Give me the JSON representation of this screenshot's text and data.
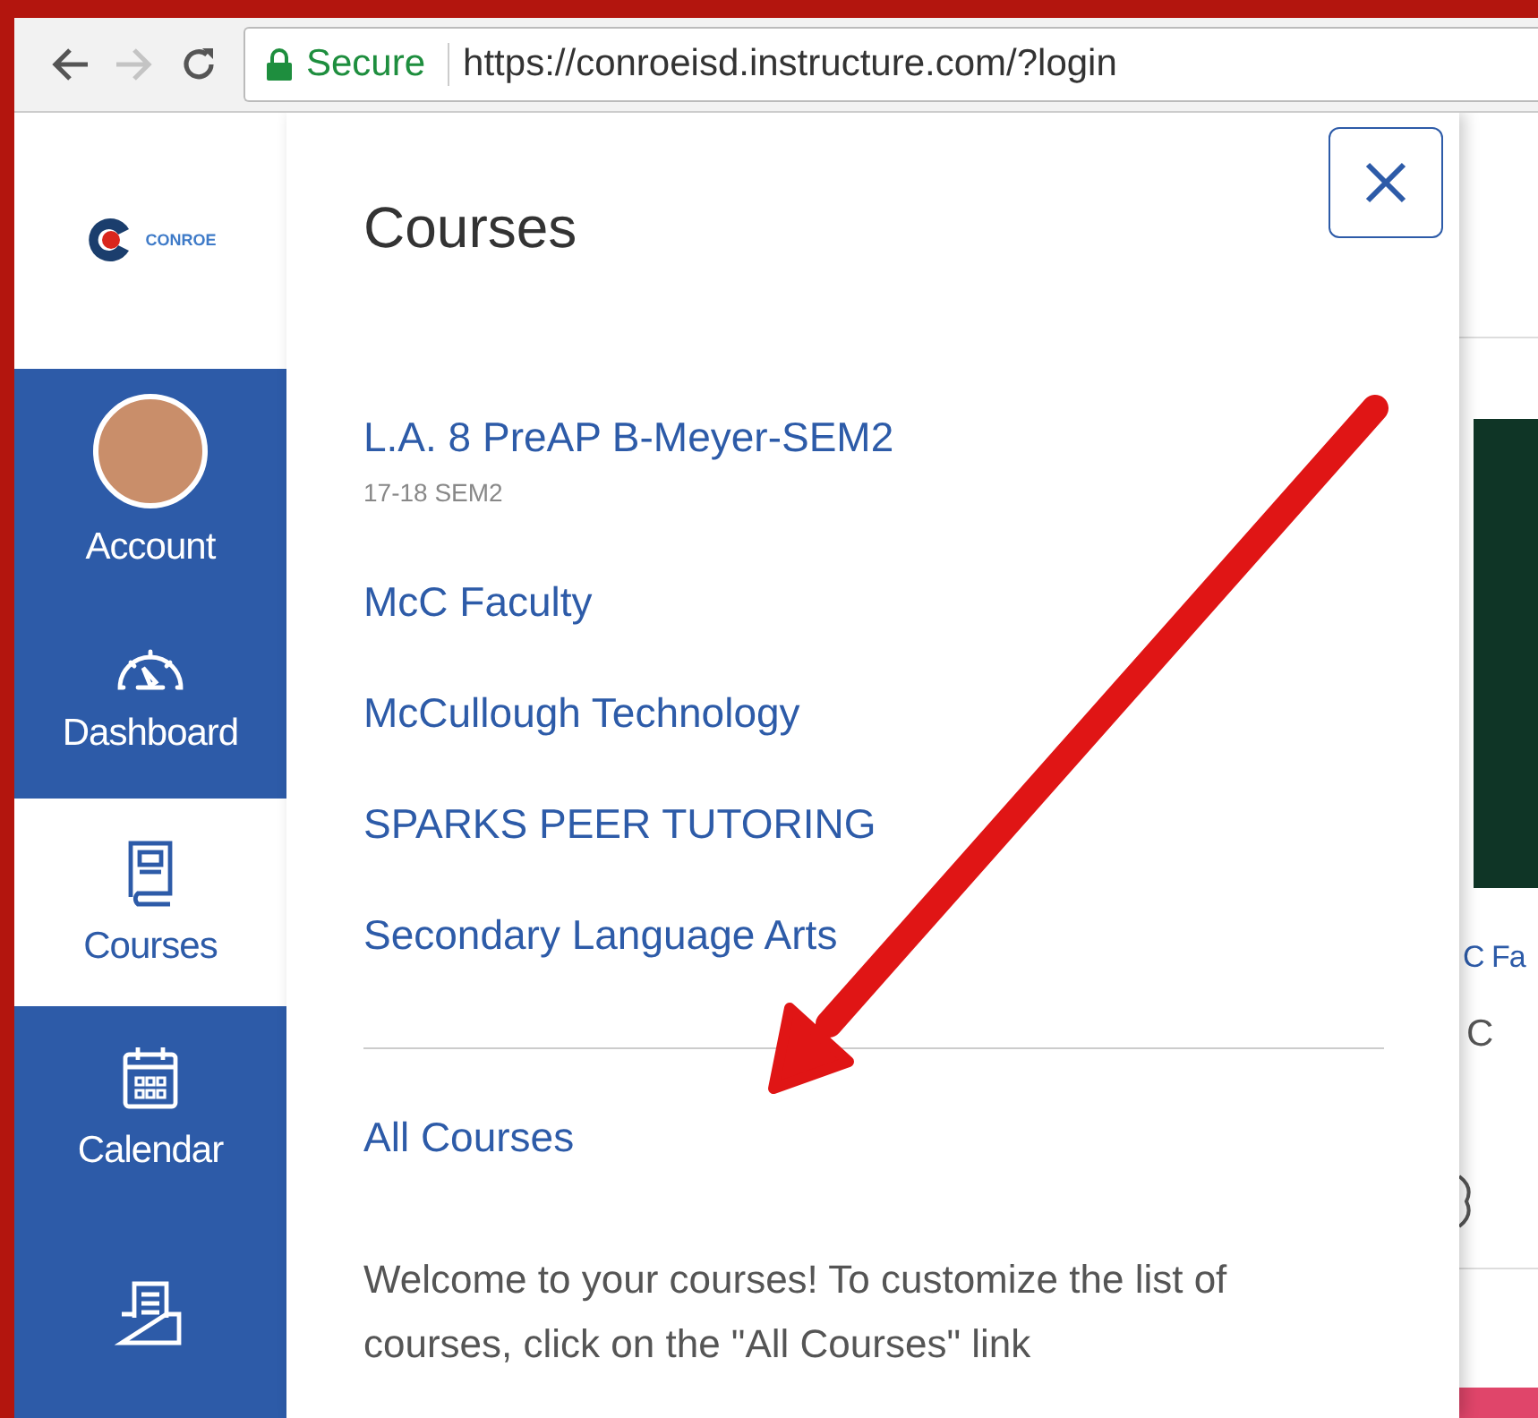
{
  "browser": {
    "back_disabled": false,
    "forward_disabled": true,
    "secure_label": "Secure",
    "url": "https://conroeisd.instructure.com/?login"
  },
  "logo": {
    "text": "CONROE"
  },
  "sidebar": {
    "items": [
      {
        "kind": "account",
        "label": "Account",
        "selected": false
      },
      {
        "kind": "dashboard",
        "label": "Dashboard",
        "selected": false
      },
      {
        "kind": "courses",
        "label": "Courses",
        "selected": true
      },
      {
        "kind": "calendar",
        "label": "Calendar",
        "selected": false
      },
      {
        "kind": "inbox",
        "selected": false
      }
    ]
  },
  "tray": {
    "title": "Courses",
    "courses": [
      {
        "name": "L.A. 8 PreAP B-Meyer-SEM2",
        "term": "17-18 SEM2"
      },
      {
        "name": "McC Faculty"
      },
      {
        "name": "McCullough Technology"
      },
      {
        "name": "SPARKS PEER TUTORING"
      },
      {
        "name": "Secondary Language Arts"
      }
    ],
    "all_courses_link": "All Courses",
    "welcome_text": "Welcome to your courses! To customize the list of courses, click on the \"All Courses\" link"
  },
  "background": {
    "card_title": "C Fa",
    "card_subtitle": "C"
  }
}
